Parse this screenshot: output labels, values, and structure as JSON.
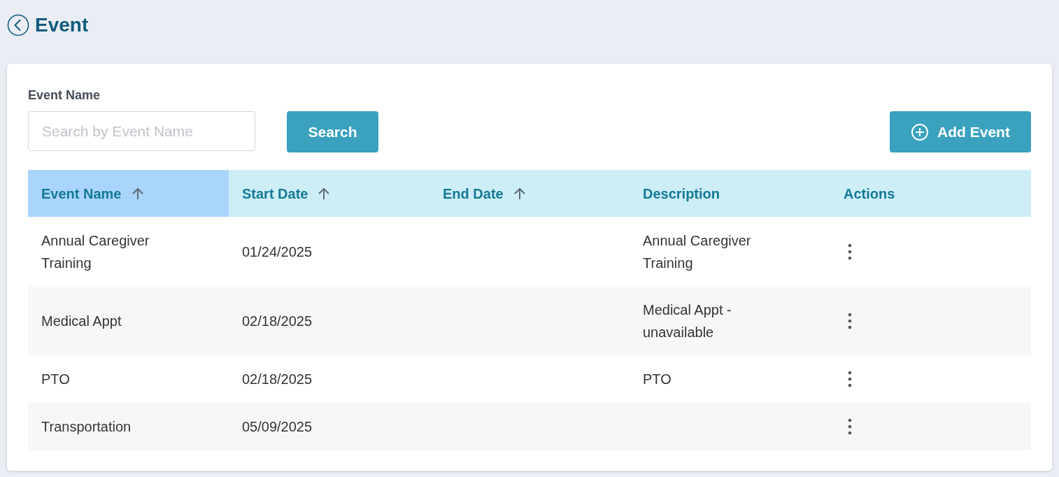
{
  "page": {
    "title": "Event"
  },
  "filter": {
    "label": "Event Name",
    "placeholder": "Search by Event Name",
    "search_button": "Search",
    "add_button": "Add Event"
  },
  "table": {
    "columns": [
      {
        "label": "Event Name",
        "sortable": true,
        "selected": true
      },
      {
        "label": "Start Date",
        "sortable": true,
        "selected": false
      },
      {
        "label": "End Date",
        "sortable": true,
        "selected": false
      },
      {
        "label": "Description",
        "sortable": false,
        "selected": false
      },
      {
        "label": "Actions",
        "sortable": false,
        "selected": false
      }
    ],
    "rows": [
      {
        "event_name": "Annual Caregiver Training",
        "start_date": "01/24/2025",
        "description": "Annual Caregiver Training"
      },
      {
        "event_name": "Medical Appt",
        "start_date": "02/18/2025",
        "description": "Medical Appt - unavailable"
      },
      {
        "event_name": "PTO",
        "start_date": "02/18/2025",
        "description": "PTO"
      },
      {
        "event_name": "Transportation",
        "start_date": "05/09/2025"
      }
    ]
  }
}
